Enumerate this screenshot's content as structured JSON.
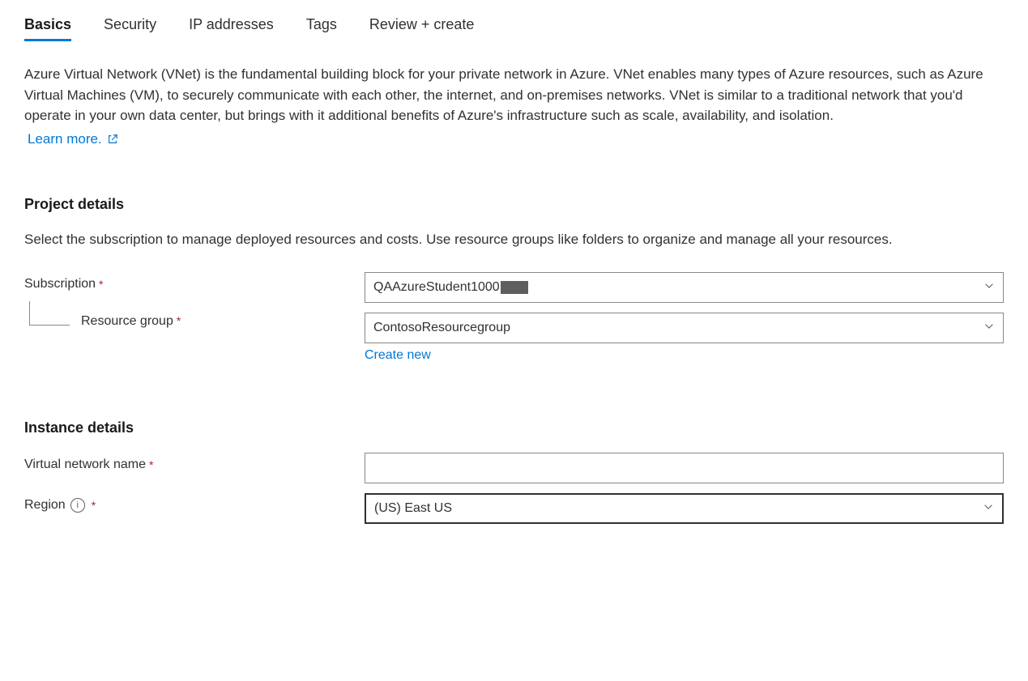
{
  "tabs": [
    {
      "label": "Basics",
      "active": true
    },
    {
      "label": "Security",
      "active": false
    },
    {
      "label": "IP addresses",
      "active": false
    },
    {
      "label": "Tags",
      "active": false
    },
    {
      "label": "Review + create",
      "active": false
    }
  ],
  "intro": {
    "text": "Azure Virtual Network (VNet) is the fundamental building block for your private network in Azure. VNet enables many types of Azure resources, such as Azure Virtual Machines (VM), to securely communicate with each other, the internet, and on-premises networks. VNet is similar to a traditional network that you'd operate in your own data center, but brings with it additional benefits of Azure's infrastructure such as scale, availability, and isolation.",
    "learn_more_label": "Learn more."
  },
  "project": {
    "heading": "Project details",
    "description": "Select the subscription to manage deployed resources and costs. Use resource groups like folders to organize and manage all your resources.",
    "subscription_label": "Subscription",
    "subscription_value": "QAAzureStudent1000",
    "resource_group_label": "Resource group",
    "resource_group_value": "ContosoResourcegroup",
    "create_new_label": "Create new"
  },
  "instance": {
    "heading": "Instance details",
    "vnet_name_label": "Virtual network name",
    "vnet_name_value": "",
    "region_label": "Region",
    "region_value": "(US) East US"
  }
}
